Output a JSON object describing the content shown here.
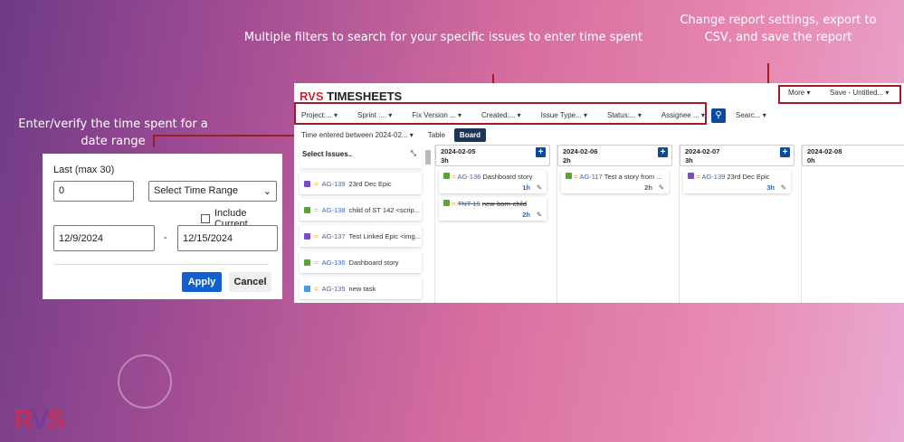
{
  "annotations": {
    "filters": "Multiple filters to search for your specific issues to enter time spent",
    "settings": "Change report settings, export to CSV, and save the report",
    "date_range": "Enter/verify the time spent for a date range"
  },
  "app": {
    "logo": "RVS",
    "title": "TIMESHEETS",
    "more": "More ▾",
    "save": "Save - Untitled... ▾"
  },
  "filters": [
    "Project:... ▾",
    "Sprint :... ▾",
    "Fix Version ... ▾",
    "Created:... ▾",
    "Issue Type... ▾",
    "Status:... ▾",
    "Assignee ... ▾"
  ],
  "search": {
    "icon": "search-icon",
    "label": "Searc... ▾"
  },
  "view": {
    "time_filter": "Time entered between 2024-02... ▾",
    "table": "Table",
    "board": "Board"
  },
  "select_issues": {
    "title": "Select Issues..",
    "items": [
      {
        "key": "AG-139",
        "summary": "23rd Dec Epic",
        "type": "epic"
      },
      {
        "key": "AG-138",
        "summary": "child of ST 142 <scrip...",
        "type": "story"
      },
      {
        "key": "AG-137",
        "summary": "Test Linked Epic <img...",
        "type": "epic"
      },
      {
        "key": "AG-136",
        "summary": "Dashboard story",
        "type": "story"
      },
      {
        "key": "AG-135",
        "summary": "new task",
        "type": "task"
      }
    ]
  },
  "columns": [
    {
      "date": "2024-02-05",
      "total": "3h",
      "cards": [
        {
          "key": "AG-136",
          "summary": "Dashboard story",
          "hours": "1h",
          "type": "story"
        },
        {
          "key": "TNT-19",
          "summary": "new-born-child",
          "hours": "2h",
          "type": "story",
          "strike": true
        }
      ]
    },
    {
      "date": "2024-02-06",
      "total": "2h",
      "cards": [
        {
          "key": "AG-117",
          "summary": "Test a story from ...",
          "hours": "2h",
          "type": "story"
        }
      ]
    },
    {
      "date": "2024-02-07",
      "total": "3h",
      "cards": [
        {
          "key": "AG-139",
          "summary": "23rd Dec Epic",
          "hours": "3h",
          "type": "epic"
        }
      ]
    },
    {
      "date": "2024-02-08",
      "total": "0h",
      "cards": []
    }
  ],
  "popup": {
    "last_label": "Last (max 30)",
    "last_value": "0",
    "range_select": "Select Time Range",
    "include_current": "Include Current",
    "start": "12/9/2024",
    "sep": "-",
    "end": "12/15/2024",
    "apply": "Apply",
    "cancel": "Cancel"
  },
  "colors": {
    "epic": "#7b4bc4",
    "story": "#5aa232",
    "task": "#4a9ae0",
    "accent": "#0b4aa0",
    "annotation_line": "#a01c24"
  }
}
